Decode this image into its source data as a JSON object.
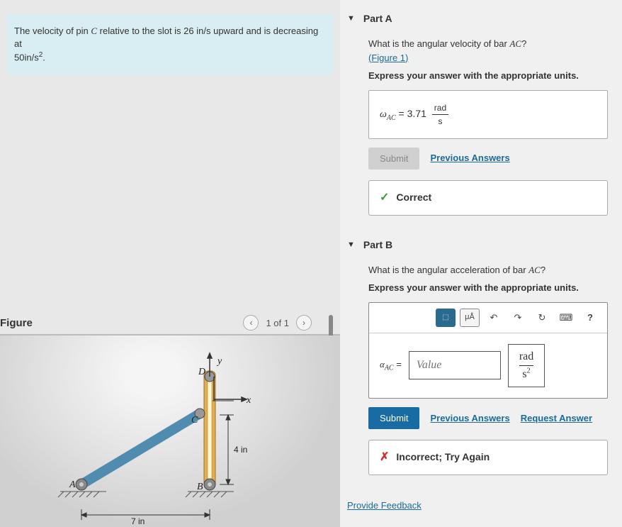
{
  "problem": {
    "text_before": "The velocity of pin ",
    "pin_symbol": "C",
    "text_mid": " relative to the slot is 26 ",
    "velocity_unit": "in/s",
    "text_mid2": " upward and is decreasing at ",
    "decel_value": "50in/s",
    "decel_exp": "2",
    "text_end": "."
  },
  "figure": {
    "title": "Figure",
    "page_current": "1",
    "page_total": "1",
    "labels": {
      "A": "A",
      "B": "B",
      "C": "C",
      "D": "D",
      "x": "x",
      "y": "y",
      "dim_horizontal": "7 in",
      "dim_vertical": "4 in"
    }
  },
  "partA": {
    "header": "Part A",
    "question": "What is the angular velocity of bar ",
    "bar_symbol": "AC",
    "question_end": "?",
    "figure_link": "(Figure 1)",
    "instruction": "Express your answer with the appropriate units.",
    "omega_symbol": "ω",
    "omega_sub": "AC",
    "equals": " = ",
    "value": "3.71",
    "unit_top": "rad",
    "unit_bot": "s",
    "submit_label": "Submit",
    "previous_label": "Previous Answers",
    "feedback": "Correct"
  },
  "partB": {
    "header": "Part B",
    "question": "What is the angular acceleration of bar ",
    "bar_symbol": "AC",
    "question_end": "?",
    "instruction": "Express your answer with the appropriate units.",
    "alpha_symbol": "α",
    "alpha_sub": "AC",
    "equals": " = ",
    "placeholder": "Value",
    "unit_top": "rad",
    "unit_bot_base": "s",
    "unit_bot_exp": "2",
    "submit_label": "Submit",
    "previous_label": "Previous Answers",
    "request_label": "Request Answer",
    "feedback": "Incorrect; Try Again",
    "toolbar": {
      "templates": "⬚",
      "units": "μÅ",
      "undo": "↶",
      "redo": "↷",
      "reset": "↻",
      "keyboard": "⌨",
      "help": "?"
    }
  },
  "provide_feedback": "Provide Feedback"
}
